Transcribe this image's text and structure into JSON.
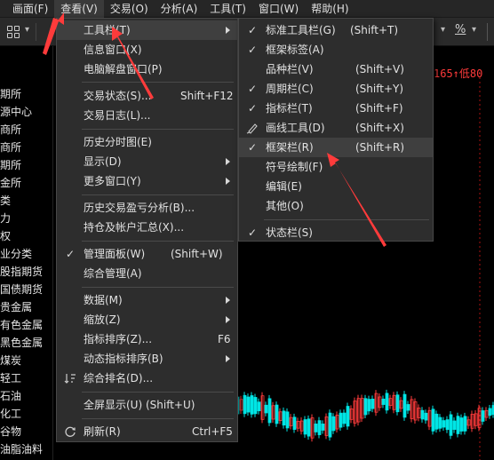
{
  "menubar": {
    "items": [
      {
        "label": "画面(F)"
      },
      {
        "label": "查看(V)"
      },
      {
        "label": "交易(O)"
      },
      {
        "label": "分析(A)"
      },
      {
        "label": "工具(T)"
      },
      {
        "label": "窗口(W)"
      },
      {
        "label": "帮助(H)"
      }
    ]
  },
  "toolbar": {
    "percent_icon": "%"
  },
  "quote": {
    "text": "165↑低80"
  },
  "left_list": {
    "items": [
      "期所",
      "源中心",
      "商所",
      "商所",
      "期所",
      "金所",
      "类",
      "力",
      "权",
      "业分类",
      "股指期货",
      "国债期货",
      "贵金属",
      "有色金属",
      "黑色金属",
      "煤炭",
      "轻工",
      "石油",
      "化工",
      "谷物",
      "油脂油料"
    ]
  },
  "view_menu": {
    "items": [
      {
        "label": "工具栏(T)",
        "shortcut": "",
        "submenu": true
      },
      {
        "label": "信息窗口(X)",
        "shortcut": ""
      },
      {
        "label": "电脑解盘窗口(P)",
        "shortcut": ""
      },
      {
        "label": "交易状态(S)...",
        "shortcut": "Shift+F12"
      },
      {
        "label": "交易日志(L)...",
        "shortcut": ""
      },
      {
        "label": "历史分时图(E)",
        "shortcut": ""
      },
      {
        "label": "显示(D)",
        "shortcut": "",
        "submenu": true
      },
      {
        "label": "更多窗口(Y)",
        "shortcut": "",
        "submenu": true
      },
      {
        "label": "历史交易盈亏分析(B)...",
        "shortcut": ""
      },
      {
        "label": "持仓及帐户汇总(X)...",
        "shortcut": ""
      },
      {
        "label": "管理面板(W)",
        "shortcut": "(Shift+W)",
        "checked": true
      },
      {
        "label": "综合管理(A)",
        "shortcut": ""
      },
      {
        "label": "数据(M)",
        "shortcut": "",
        "submenu": true
      },
      {
        "label": "缩放(Z)",
        "shortcut": "",
        "submenu": true
      },
      {
        "label": "指标排序(Z)...",
        "shortcut": "F6"
      },
      {
        "label": "动态指标排序(B)",
        "shortcut": "",
        "submenu": true
      },
      {
        "label": "综合排名(D)...",
        "shortcut": ""
      },
      {
        "label": "全屏显示(U) (Shift+U)",
        "shortcut": ""
      },
      {
        "label": "刷新(R)",
        "shortcut": "Ctrl+F5"
      }
    ]
  },
  "toolbar_submenu": {
    "items": [
      {
        "label": "标准工具栏(G)",
        "shortcut": "(Shift+T)",
        "checked": true
      },
      {
        "label": "框架标签(A)",
        "shortcut": "",
        "checked": true
      },
      {
        "label": "品种栏(V)",
        "shortcut": "(Shift+V)"
      },
      {
        "label": "周期栏(C)",
        "shortcut": "(Shift+Y)",
        "checked": true
      },
      {
        "label": "指标栏(T)",
        "shortcut": "(Shift+F)",
        "checked": true
      },
      {
        "label": "画线工具(D)",
        "shortcut": "(Shift+X)"
      },
      {
        "label": "框架栏(R)",
        "shortcut": "(Shift+R)",
        "checked": true
      },
      {
        "label": "符号绘制(F)",
        "shortcut": ""
      },
      {
        "label": "编辑(E)",
        "shortcut": ""
      },
      {
        "label": "其他(O)",
        "shortcut": ""
      },
      {
        "label": "状态栏(S)",
        "shortcut": "",
        "checked": true
      }
    ]
  },
  "colors": {
    "annotation_arrow": "#ff3b3b",
    "candle_up": "#ff3b3b",
    "candle_down": "#00e5e5"
  }
}
